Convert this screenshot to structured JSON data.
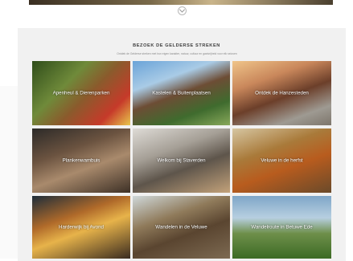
{
  "section": {
    "heading": "BEZOEK DE GELDERSE STREKEN",
    "subtext": "Ontdek de Gelderse streken met hun eigen karakter, natuur, cultuur en gastvrijheid voor elk seizoen"
  },
  "tiles": [
    {
      "label": "Apenheul & Dierenparken",
      "bg": "linear-gradient(135deg,#2f4d1a 0%,#6f8a3a 35%,#8a5b2c 55%,#c63a2a 80%,#e8c64c 100%)"
    },
    {
      "label": "Kastelen & Buitenplaatsen",
      "bg": "linear-gradient(160deg,#6aa3d8 0%,#a9cbe6 30%,#6d4d35 50%,#3f6b2e 75%,#88a85a 100%)"
    },
    {
      "label": "Ontdek de Hanzesteden",
      "bg": "linear-gradient(160deg,#f0c58a 0%,#c9875b 30%,#6c3f2a 55%,#9e9a92 80%,#7d756b 100%)"
    },
    {
      "label": "Plankenwambuis",
      "bg": "linear-gradient(160deg,#2c2a28 0%,#6b5340 35%,#a98a6c 60%,#3d3026 100%)"
    },
    {
      "label": "Welkom bij Staverden",
      "bg": "linear-gradient(160deg,#dedbd6 0%,#a59f96 35%,#5e554b 60%,#c3a27a 100%)"
    },
    {
      "label": "Veluwe in de herfst",
      "bg": "linear-gradient(160deg,#d6c6a2 0%,#a97a3a 35%,#b85c1e 60%,#6a4a2a 100%)"
    },
    {
      "label": "Harderwijk bij Avond",
      "bg": "linear-gradient(160deg,#1d2d3a 0%,#b06a2a 35%,#e7b34a 55%,#3a2b20 100%)"
    },
    {
      "label": "Wandelen in de Veluwe",
      "bg": "linear-gradient(160deg,#cfd8da 0%,#8f7a5a 35%,#5a4530 60%,#7d6a52 100%)"
    },
    {
      "label": "Wandelroute in Betuwe Ede",
      "bg": "linear-gradient(180deg,#7fa6c8 0%,#b7cfe0 35%,#6e8f4a 60%,#3c6a24 100%)"
    }
  ]
}
